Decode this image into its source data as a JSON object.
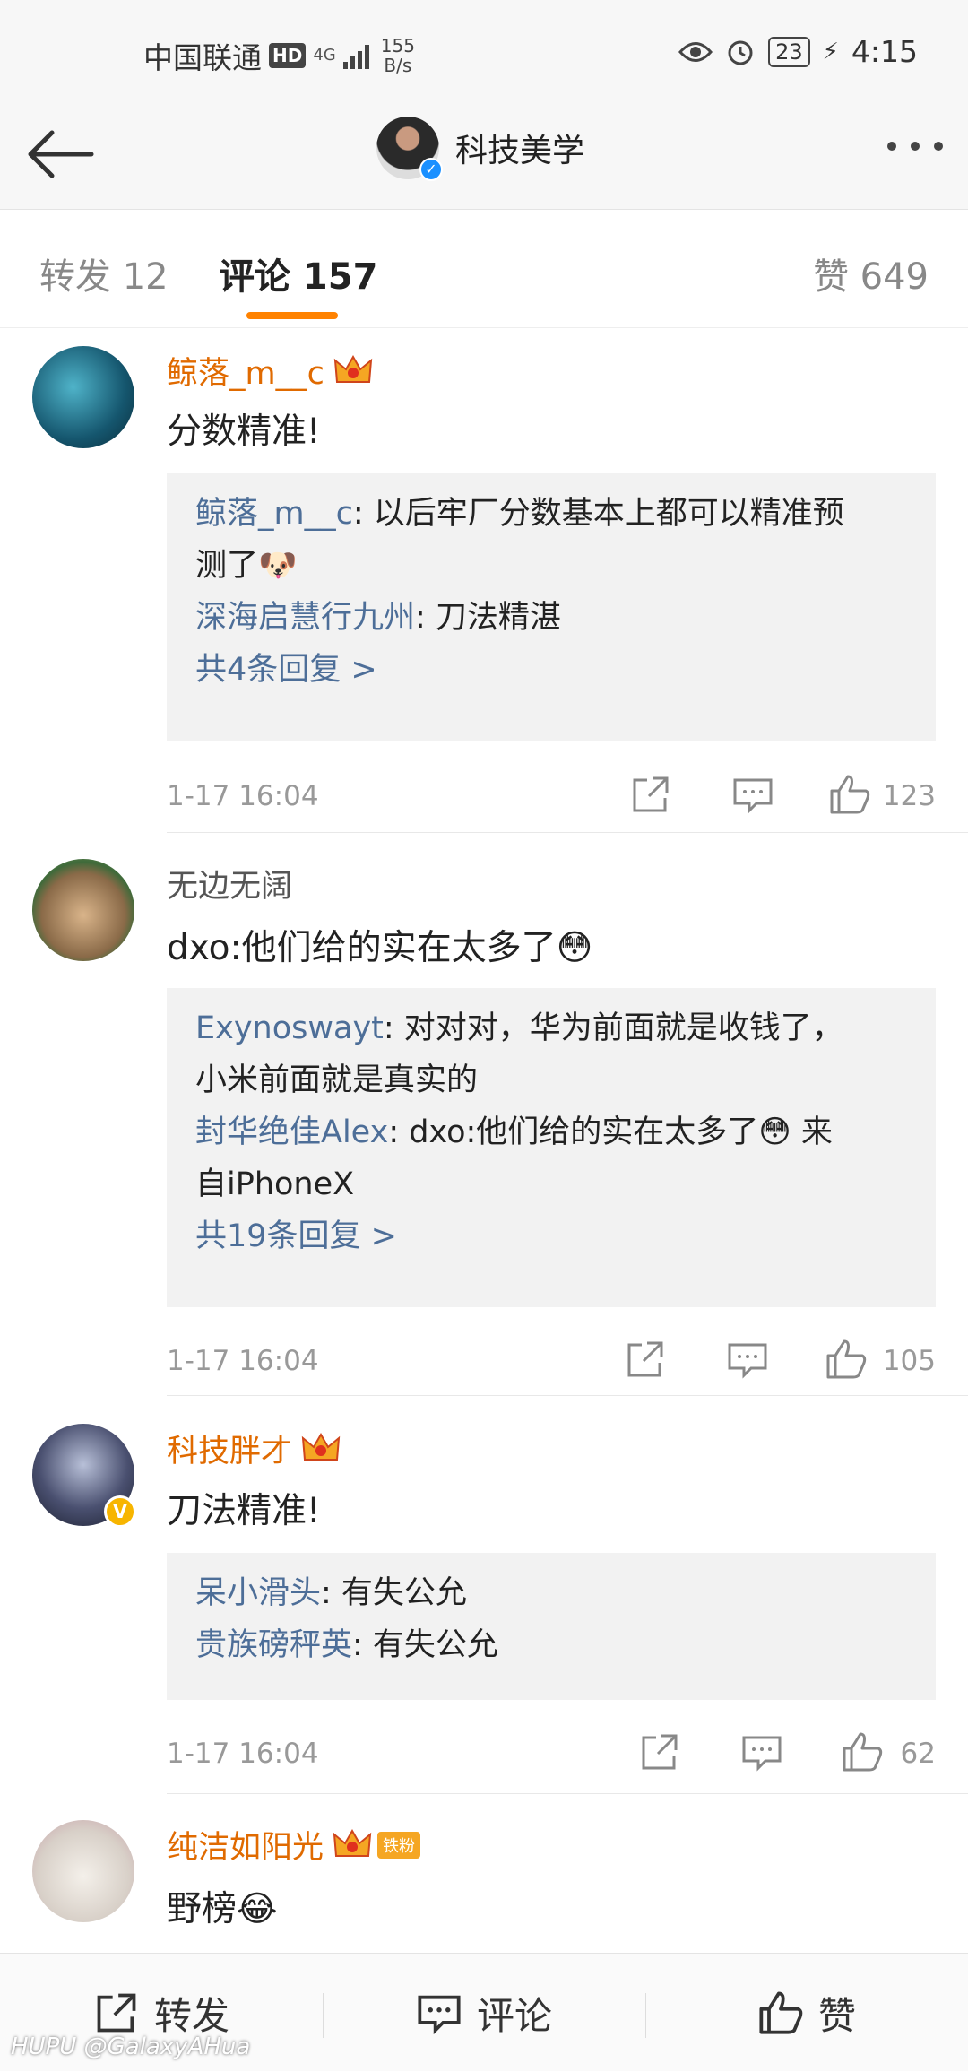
{
  "status_bar": {
    "carrier": "中国联通",
    "hd": "HD",
    "network": "4G",
    "speed_value": "155",
    "speed_unit": "B/s",
    "battery": "23",
    "time": "4:15"
  },
  "nav": {
    "title": "科技美学"
  },
  "tabs": [
    {
      "label": "转发 12"
    },
    {
      "label": "评论 157"
    },
    {
      "label": "赞 649"
    }
  ],
  "comments": [
    {
      "username": "鲸落_m__c",
      "text": "分数精准!",
      "replies": [
        {
          "name": "鲸落_m__c",
          "text": ": 以后牢厂分数基本上都可以精准预"
        },
        {
          "name": "",
          "text": "测了🐶"
        },
        {
          "name": "深海启慧行九州",
          "text": ": 刀法精湛"
        }
      ],
      "more_replies": "共4条回复 >",
      "time": "1-17 16:04",
      "likes": "123"
    },
    {
      "username": "无边无阔",
      "text": "dxo:他们给的实在太多了😳",
      "replies": [
        {
          "name": "Exynoswayt",
          "text": ": 对对对，华为前面就是收钱了，"
        },
        {
          "name": "",
          "text": "小米前面就是真实的"
        },
        {
          "name": "封华绝佳Alex",
          "text": ": dxo:他们给的实在太多了😳 来"
        },
        {
          "name": "",
          "text": "自iPhoneX"
        }
      ],
      "more_replies": "共19条回复 >",
      "time": "1-17 16:04",
      "likes": "105"
    },
    {
      "username": "科技胖才",
      "text": "刀法精准!",
      "replies": [
        {
          "name": "呆小滑头",
          "text": ": 有失公允"
        },
        {
          "name": "贵族磅秤英",
          "text": ": 有失公允"
        }
      ],
      "more_replies": "",
      "time": "1-17 16:04",
      "likes": "62"
    },
    {
      "username": "纯洁如阳光",
      "badge": "铁粉",
      "text": "野榜😂"
    }
  ],
  "bottom_bar": {
    "repost": "转发",
    "comment": "评论",
    "like": "赞"
  },
  "watermark": "HUPU @GalaxyAHua",
  "colors": {
    "accent": "#ff8200",
    "link": "#4d6e98",
    "vip_name": "#e06a00"
  }
}
